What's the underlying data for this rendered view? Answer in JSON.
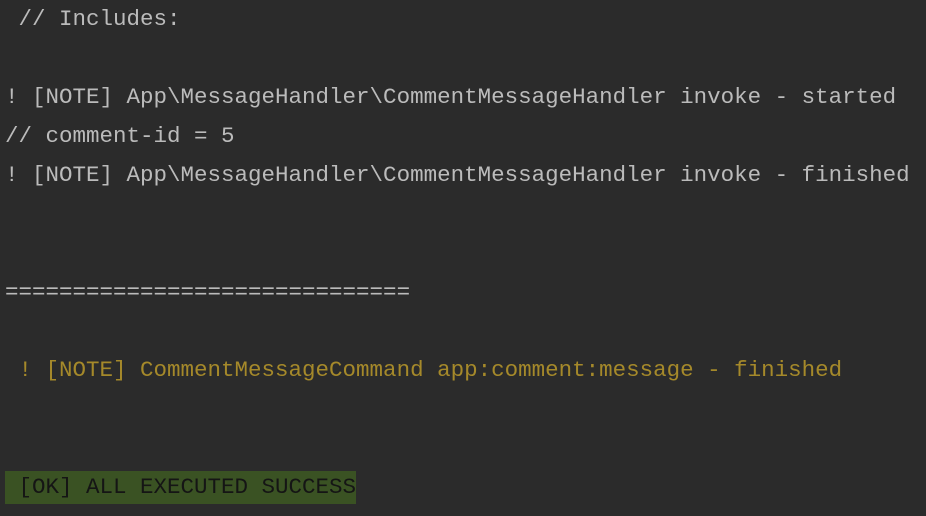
{
  "terminal": {
    "lines": [
      {
        "text": " // Includes:",
        "style": "default"
      },
      {
        "text": "",
        "style": "default"
      },
      {
        "text": "! [NOTE] App\\MessageHandler\\CommentMessageHandler invoke - started",
        "style": "default"
      },
      {
        "text": "// comment-id = 5",
        "style": "default"
      },
      {
        "text": "! [NOTE] App\\MessageHandler\\CommentMessageHandler invoke - finished",
        "style": "default"
      },
      {
        "text": "",
        "style": "default"
      },
      {
        "text": "",
        "style": "default"
      },
      {
        "text": "==============================",
        "style": "default"
      },
      {
        "text": "",
        "style": "default"
      },
      {
        "text": " ! [NOTE] CommentMessageCommand app:comment:message - finished",
        "style": "note"
      },
      {
        "text": "",
        "style": "default"
      },
      {
        "text": "",
        "style": "default"
      },
      {
        "text": " [OK] ALL EXECUTED SUCCESS",
        "style": "ok"
      }
    ],
    "colors": {
      "background": "#2b2b2b",
      "text": "#bbbbbb",
      "note": "#a5892a",
      "ok_background": "#3a5223",
      "ok_text": "#151515"
    }
  }
}
